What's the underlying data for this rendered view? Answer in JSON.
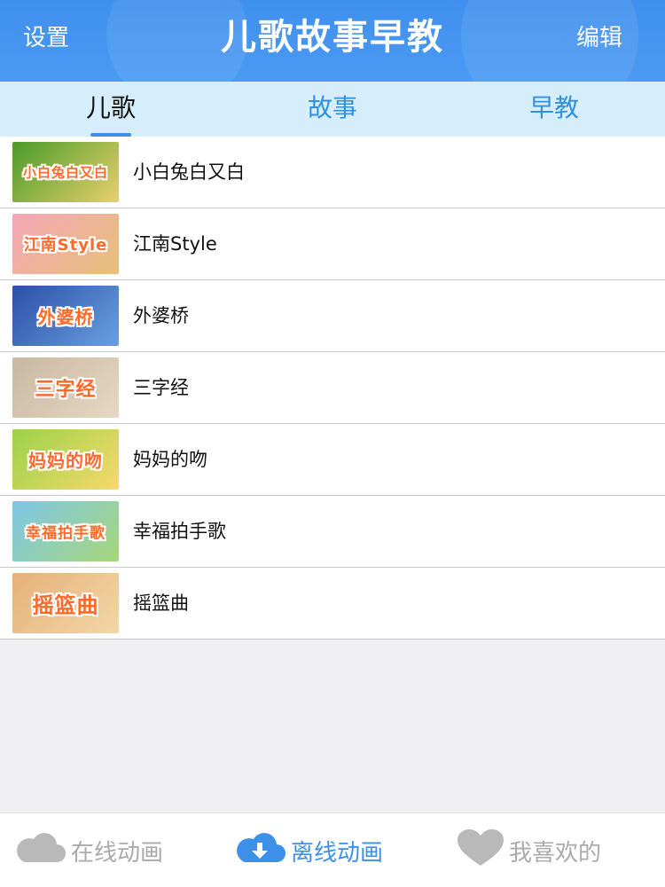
{
  "header": {
    "settings_label": "设置",
    "title": "儿歌故事早教",
    "edit_label": "编辑"
  },
  "tabs": [
    {
      "label": "儿歌",
      "active": true
    },
    {
      "label": "故事",
      "active": false
    },
    {
      "label": "早教",
      "active": false
    }
  ],
  "songs": [
    {
      "title": "小白兔白又白",
      "thumb_text": "小白兔白又白",
      "thumb_colors": [
        "#4a9a2a",
        "#e8d06a"
      ]
    },
    {
      "title": "江南Style",
      "thumb_text": "江南Style",
      "thumb_colors": [
        "#f4a7b7",
        "#e7c07a"
      ]
    },
    {
      "title": "外婆桥",
      "thumb_text": "外婆桥",
      "thumb_colors": [
        "#2b4fa8",
        "#6aa0e0"
      ]
    },
    {
      "title": "三字经",
      "thumb_text": "三字经",
      "thumb_colors": [
        "#c9b7a0",
        "#e6d8c4"
      ]
    },
    {
      "title": "妈妈的吻",
      "thumb_text": "妈妈的吻",
      "thumb_colors": [
        "#9bd24a",
        "#f7d96a"
      ]
    },
    {
      "title": "幸福拍手歌",
      "thumb_text": "幸福拍手歌",
      "thumb_colors": [
        "#7ec6e8",
        "#a7d77a"
      ]
    },
    {
      "title": "摇篮曲",
      "thumb_text": "摇篮曲",
      "thumb_colors": [
        "#e6b07a",
        "#f2d7a6"
      ]
    }
  ],
  "tabbar": {
    "online_label": "在线动画",
    "offline_label": "离线动画",
    "favorites_label": "我喜欢的",
    "online_icon": "cloud-icon",
    "offline_icon": "cloud-download-icon",
    "favorites_icon": "heart-icon"
  },
  "colors": {
    "header_bg": "#4592ef",
    "tab_bg": "#d6eefc",
    "accent": "#3c90e8",
    "inactive": "#aaaaaa",
    "thumb_text": "#ff6a2a"
  }
}
